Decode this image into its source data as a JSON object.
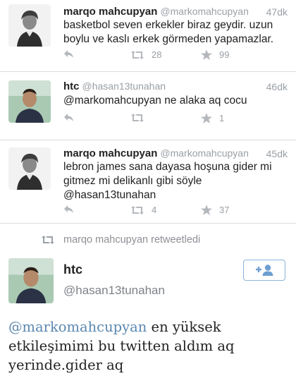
{
  "tweets": [
    {
      "name": "marqo mahcupyan",
      "handle": "@markomahcupyan",
      "time": "47dk",
      "text_lines": [
        "basketbol seven erkekler biraz geydir. uzun",
        "boylu ve kaslı erkek görmeden yapamazlar."
      ],
      "retweets": "28",
      "favorites": "99",
      "avatar_icon": "portrait-engraving"
    },
    {
      "name": "htc",
      "handle": "@hasan13tunahan",
      "time": "46dk",
      "text_lines": [
        "@markomahcupyan ne alaka aq cocu"
      ],
      "retweets": "",
      "favorites": "1",
      "avatar_icon": "man-photo"
    },
    {
      "name": "marqo mahcupyan",
      "handle": "@markomahcupyan",
      "time": "45dk",
      "text_lines": [
        "lebron james sana dayasa hoşuna gider mi",
        "gitmez mi delikanlı gibi söyle",
        "@hasan13tunahan"
      ],
      "retweets": "4",
      "favorites": "37",
      "avatar_icon": "portrait-engraving"
    }
  ],
  "retweet_notice": "marqo mahcupyan retweetledi",
  "featured": {
    "name": "htc",
    "handle": "@hasan13tunahan",
    "mention": "@markomahcupyan",
    "text_after_mention": " en yüksek etkileşimimi bu twitten aldım aq yerinde.gider aq",
    "follow_icon": "add-user-icon"
  },
  "colors": {
    "icon_gray": "#b4b8bd",
    "mention_blue": "#5b87b0",
    "follow_blue": "#6d9fd1"
  }
}
